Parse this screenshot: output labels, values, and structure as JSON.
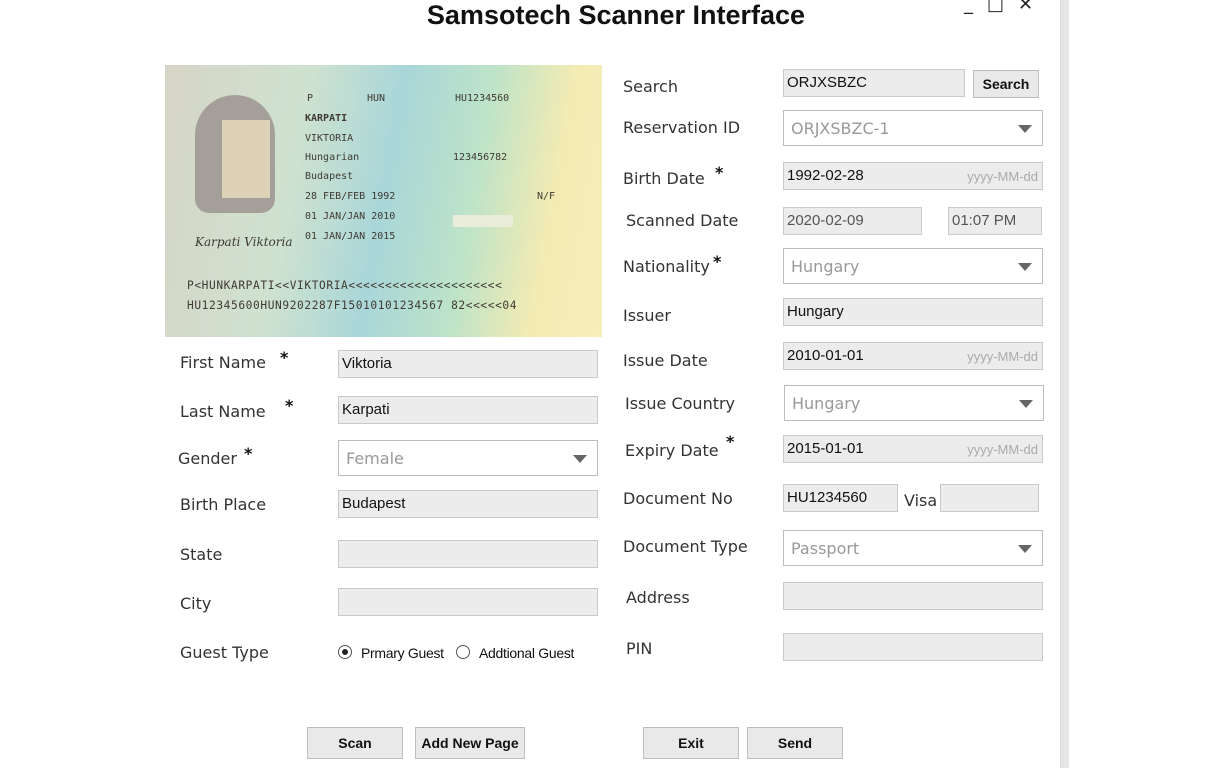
{
  "window": {
    "title": "Samsotech Scanner Interface",
    "controls": [
      "_",
      "□",
      "✕"
    ]
  },
  "passport": {
    "type_code": "P",
    "country_code": "HUN",
    "doc_number": "HU1234560",
    "surname": "KARPATI",
    "given_name": "VIKTORIA",
    "nationality": "Hungarian",
    "personal_number": "123456782",
    "birth_place": "Budapest",
    "birth_date": "28 FEB/FEB 1992",
    "sex": "N/F",
    "issue_date": "01 JAN/JAN 2010",
    "expiry_date": "01 JAN/JAN 2015",
    "signature": "Karpati Viktoria",
    "mrz_line1": "P<HUNKARPATI<<VIKTORIA<<<<<<<<<<<<<<<<<<<<<",
    "mrz_line2": "HU12345600HUN9202287F15010101234567 82<<<<<04"
  },
  "form_left": {
    "first_name": {
      "label": "First Name",
      "required": "*",
      "value": "Viktoria"
    },
    "last_name": {
      "label": "Last Name",
      "required": "*",
      "value": "Karpati"
    },
    "gender": {
      "label": "Gender",
      "required": "*",
      "value": "Female"
    },
    "birth_place": {
      "label": "Birth Place",
      "value": "Budapest"
    },
    "state": {
      "label": "State",
      "value": ""
    },
    "city": {
      "label": "City",
      "value": ""
    },
    "guest_type": {
      "label": "Guest Type",
      "options": [
        "Prmary Guest",
        "Addtional Guest"
      ],
      "selected": "Prmary Guest"
    }
  },
  "form_right": {
    "search": {
      "label": "Search",
      "value": "ORJXSBZC",
      "button": "Search"
    },
    "reservation_id": {
      "label": "Reservation ID",
      "value": "ORJXSBZC-1"
    },
    "birth_date": {
      "label": "Birth Date",
      "required": "*",
      "value": "1992-02-28",
      "hint": "yyyy-MM-dd"
    },
    "scanned_date": {
      "label": "Scanned Date",
      "date": "2020-02-09",
      "time": "01:07 PM"
    },
    "nationality": {
      "label": "Nationality",
      "required": "*",
      "value": "Hungary"
    },
    "issuer": {
      "label": "Issuer",
      "value": "Hungary"
    },
    "issue_date": {
      "label": "Issue Date",
      "value": "2010-01-01",
      "hint": "yyyy-MM-dd"
    },
    "issue_country": {
      "label": "Issue Country",
      "value": "Hungary"
    },
    "expiry_date": {
      "label": "Expiry Date",
      "required": "*",
      "value": "2015-01-01",
      "hint": "yyyy-MM-dd"
    },
    "document_no": {
      "label": "Document No",
      "value": "HU1234560",
      "visa_label": "Visa",
      "visa_value": ""
    },
    "document_type": {
      "label": "Document Type",
      "value": "Passport"
    },
    "address": {
      "label": "Address",
      "value": ""
    },
    "pin": {
      "label": "PIN",
      "value": ""
    }
  },
  "buttons": {
    "scan": "Scan",
    "add_new_page": "Add New Page",
    "exit": "Exit",
    "send": "Send"
  }
}
